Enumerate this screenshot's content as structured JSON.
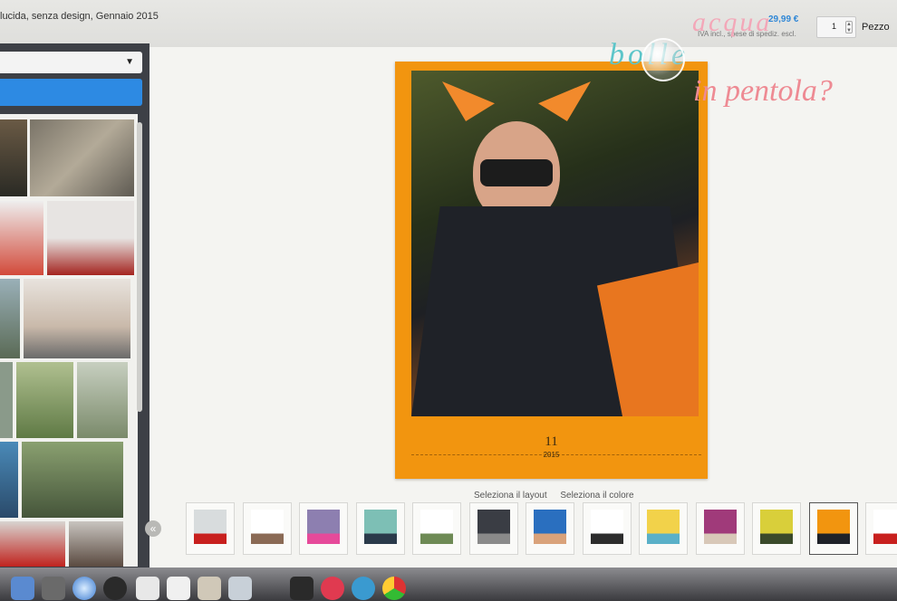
{
  "product": {
    "title": "lucida, senza design, Gennaio 2015",
    "price": "29,99 €",
    "price_note": "IVA incl., spese di spediz. escl.",
    "quantity": "1",
    "quantity_unit": "Pezzo"
  },
  "sidebar": {
    "dropdown_value": "",
    "action_button_label": ""
  },
  "calendar_preview": {
    "month_number": "11",
    "year": "2015",
    "frame_color": "#f2950f"
  },
  "options": {
    "select_layout": "Seleziona il layout",
    "select_color": "Seleziona il colore"
  },
  "template_strip": {
    "prev_icon": "«",
    "thumbnails": [
      {
        "name": "template-1",
        "color": "#d8dcdd",
        "accent": "#c8201e"
      },
      {
        "name": "template-2",
        "color": "#ffffff",
        "accent": "#8a6a55"
      },
      {
        "name": "template-3",
        "color": "#8d7fb0",
        "accent": "#e64a9a"
      },
      {
        "name": "template-4",
        "color": "#7dbfb5",
        "accent": "#2a3a4a"
      },
      {
        "name": "template-5",
        "color": "#ffffff",
        "accent": "#6e8a55"
      },
      {
        "name": "template-6",
        "color": "#3a3d44",
        "accent": "#8a8a8a"
      },
      {
        "name": "template-7",
        "color": "#2a6fbf",
        "accent": "#d9a27a"
      },
      {
        "name": "template-8",
        "color": "#ffffff",
        "accent": "#2c2c2c"
      },
      {
        "name": "template-9",
        "color": "#f2d24a",
        "accent": "#5ab0c8"
      },
      {
        "name": "template-10",
        "color": "#a03a7a",
        "accent": "#d8c8b8"
      },
      {
        "name": "template-11",
        "color": "#d9cf3a",
        "accent": "#3a4a2a"
      },
      {
        "name": "template-12",
        "color": "#f2950f",
        "accent": "#1f2228",
        "active": true
      },
      {
        "name": "template-13",
        "color": "#ffffff",
        "accent": "#c8201e"
      }
    ]
  },
  "watermark": {
    "line1": "acqua",
    "line2": "bolle",
    "line3": "in pentola?"
  },
  "colors": {
    "accent_blue": "#2d8ae3",
    "sidebar_dark": "#3d4046",
    "price_blue": "#2f87d6"
  }
}
